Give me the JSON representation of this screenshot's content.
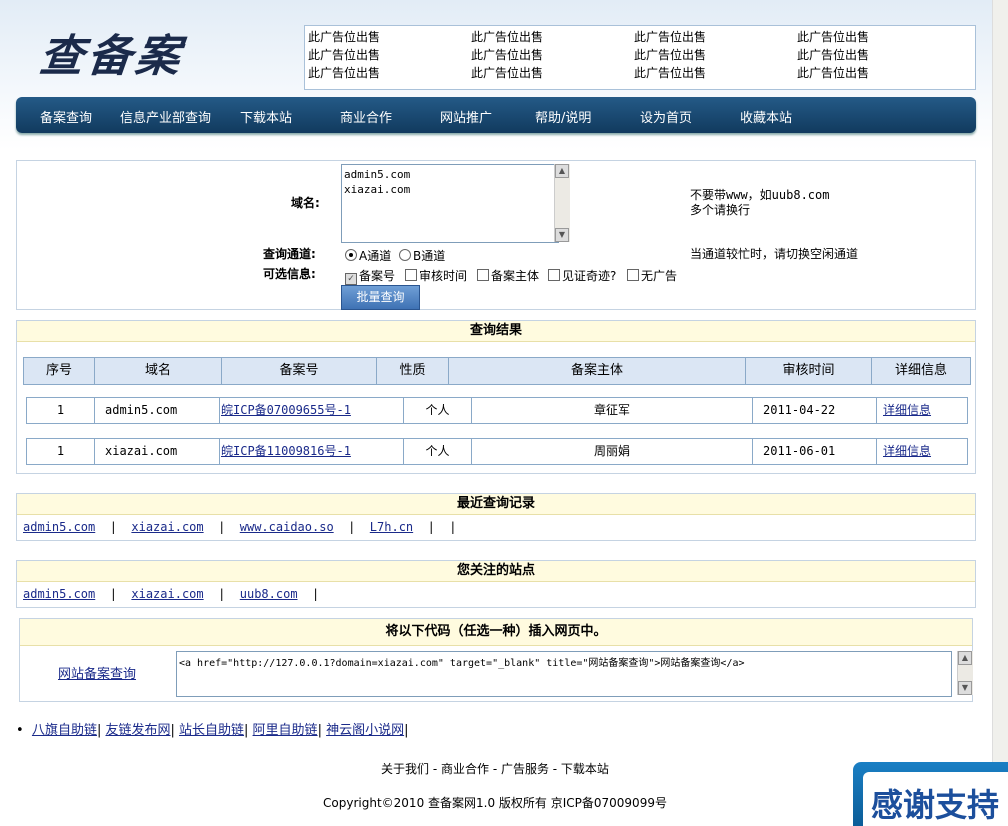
{
  "header": {
    "logo_text": "查备案",
    "ads": [
      "此广告位出售",
      "此广告位出售",
      "此广告位出售",
      "此广告位出售",
      "此广告位出售",
      "此广告位出售",
      "此广告位出售",
      "此广告位出售",
      "此广告位出售",
      "此广告位出售",
      "此广告位出售",
      "此广告位出售"
    ]
  },
  "nav": [
    "备案查询",
    "信息产业部查询",
    "下载本站",
    "商业合作",
    "网站推广",
    "帮助/说明",
    "设为首页",
    "收藏本站"
  ],
  "form": {
    "domain_label": "域名:",
    "domain_value": "admin5.com\nxiazai.com",
    "hint1": "不要带www，如uub8.com",
    "hint2": "多个请换行",
    "channel_label": "查询通道:",
    "channel_a": "A通道",
    "channel_b": "B通道",
    "channel_hint": "当通道较忙时，请切换空闲通道",
    "options_label": "可选信息:",
    "options": [
      "备案号",
      "审核时间",
      "备案主体",
      "见证奇迹?",
      "无广告"
    ],
    "submit": "批量查询"
  },
  "results": {
    "title": "查询结果",
    "columns": [
      "序号",
      "域名",
      "备案号",
      "性质",
      "备案主体",
      "审核时间",
      "详细信息"
    ],
    "rows": [
      {
        "no": "1",
        "domain": "admin5.com",
        "icp": "皖ICP备07009655号-1",
        "type": "个人",
        "owner": "章征军",
        "date": "2011-04-22",
        "detail": "详细信息"
      },
      {
        "no": "1",
        "domain": "xiazai.com",
        "icp": "皖ICP备11009816号-1",
        "type": "个人",
        "owner": "周丽娟",
        "date": "2011-06-01",
        "detail": "详细信息"
      }
    ]
  },
  "recent": {
    "title": "最近查询记录",
    "items": [
      "admin5.com",
      "xiazai.com",
      "www.caidao.so",
      "L7h.cn"
    ]
  },
  "watched": {
    "title": "您关注的站点",
    "items": [
      "admin5.com",
      "xiazai.com",
      "uub8.com"
    ]
  },
  "code": {
    "title": "将以下代码（任选一种）插入网页中。",
    "link_label": "网站备案查询",
    "snippet": "<a href=\"http://127.0.0.1?domain=xiazai.com\" target=\"_blank\" title=\"网站备案查询\">网站备案查询</a>"
  },
  "friend_links": [
    "八旗自助链",
    "友链发布网",
    "站长自助链",
    "阿里自助链",
    "神云阁小说网"
  ],
  "footer": {
    "links": "关于我们 - 商业合作 - 广告服务 - 下载本站",
    "copyright": "Copyright©2010 查备案网1.0 版权所有 京ICP备07009099号"
  },
  "float_banner": "感谢支持"
}
